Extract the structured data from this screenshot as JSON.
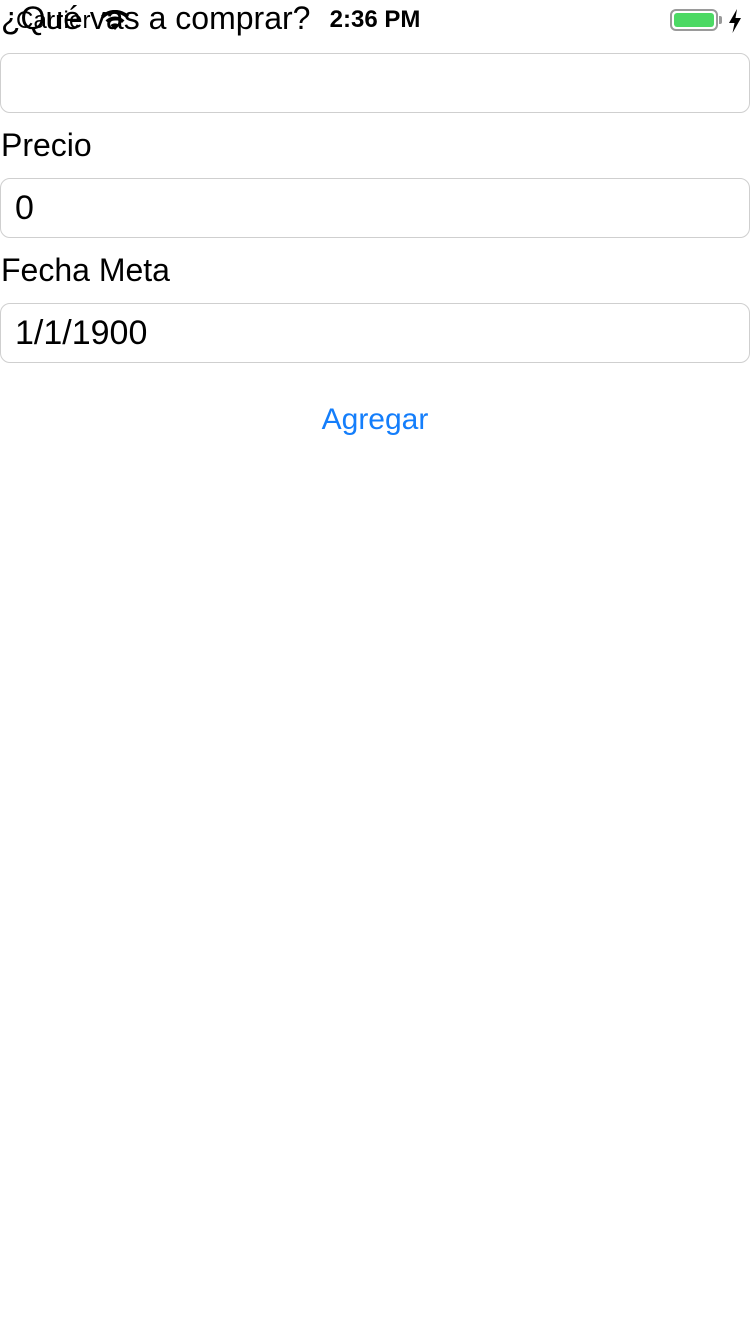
{
  "status_bar": {
    "carrier": "Carrier",
    "time": "2:36 PM",
    "battery_level": 1.0,
    "battery_color": "#4cd964",
    "icons": [
      "wifi-icon",
      "battery-icon",
      "charging-bolt-icon"
    ]
  },
  "form": {
    "item_label": "¿Qué vas a comprar?",
    "item_value": "",
    "price_label": "Precio",
    "price_value": "0",
    "date_label": "Fecha Meta",
    "date_value": "1/1/1900",
    "add_button_label": "Agregar"
  },
  "colors": {
    "accent": "#147efb",
    "input_border": "#cfcfcf",
    "background": "#ffffff"
  }
}
